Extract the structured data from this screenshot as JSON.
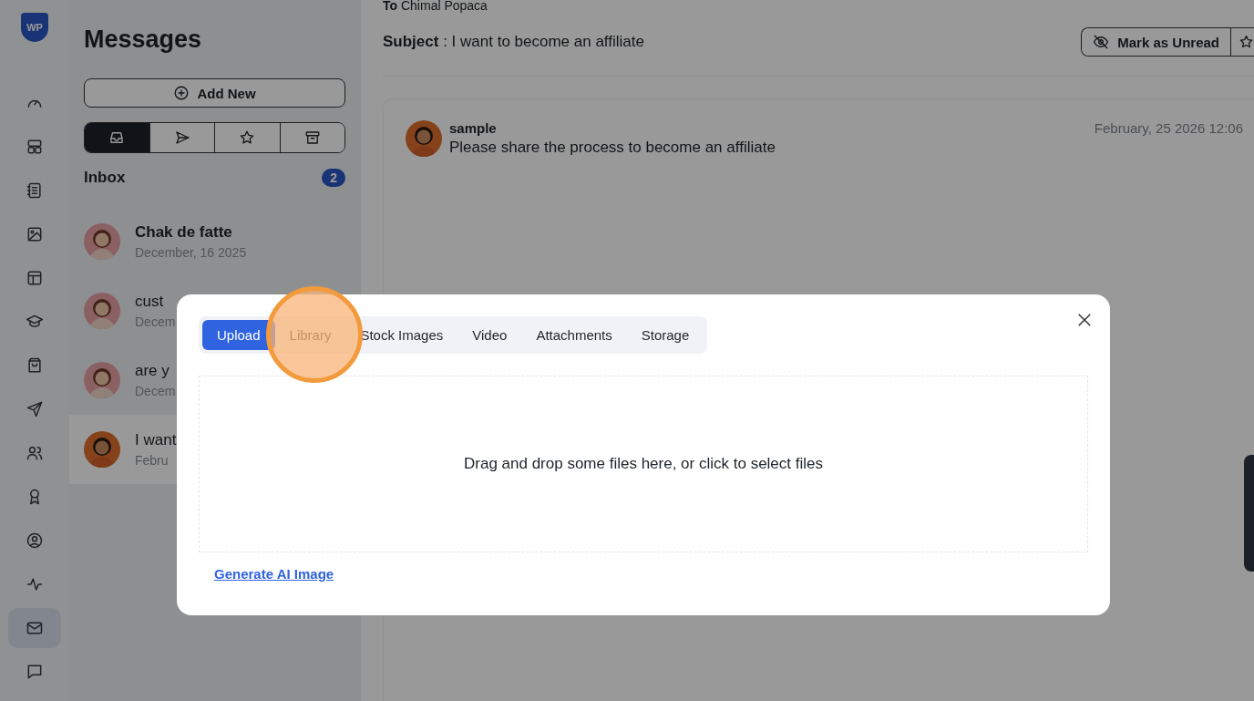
{
  "brand": {
    "logo_text": "WP"
  },
  "nav_items": [
    {
      "selected": false
    },
    {
      "selected": false
    },
    {
      "selected": false
    },
    {
      "selected": false
    },
    {
      "selected": false
    },
    {
      "selected": false
    },
    {
      "selected": false
    },
    {
      "selected": false
    },
    {
      "selected": false
    },
    {
      "selected": false
    },
    {
      "selected": false
    },
    {
      "selected": false
    },
    {
      "selected": true
    },
    {
      "selected": false
    }
  ],
  "list_panel": {
    "title": "Messages",
    "add_button": "Add New"
  },
  "folder_tabs": [
    {
      "selected": true
    },
    {
      "selected": false
    },
    {
      "selected": false
    },
    {
      "selected": false
    }
  ],
  "inbox": {
    "label": "Inbox",
    "count": "2"
  },
  "conversations": [
    {
      "name": "Chak de fatte",
      "date": "December, 16 2025",
      "unread": true,
      "selected": false
    },
    {
      "name": "cust",
      "date": "Decem",
      "unread": false,
      "selected": false
    },
    {
      "name": "are y",
      "date": "Decem",
      "unread": false,
      "selected": false
    },
    {
      "name": "I want",
      "date": "Febru",
      "unread": false,
      "selected": true
    }
  ],
  "message": {
    "to_label": "To",
    "to_value": "Chimal Popaca",
    "subject_label": "Subject",
    "subject_text": ": I want to become an affiliate",
    "mark_unread_button": "Mark as Unread",
    "sender": "sample",
    "body": "Please share the process to become an affiliate",
    "date": "February, 25 2026 12:06"
  },
  "modal": {
    "tabs": [
      {
        "label": "Upload",
        "selected": true
      },
      {
        "label": "Library",
        "selected": false
      },
      {
        "label": "Stock Images",
        "selected": false
      },
      {
        "label": "Video",
        "selected": false
      },
      {
        "label": "Attachments",
        "selected": false
      },
      {
        "label": "Storage",
        "selected": false
      }
    ],
    "dropzone_text": "Drag and drop some files here, or click to select files",
    "link": "Generate AI Image"
  }
}
